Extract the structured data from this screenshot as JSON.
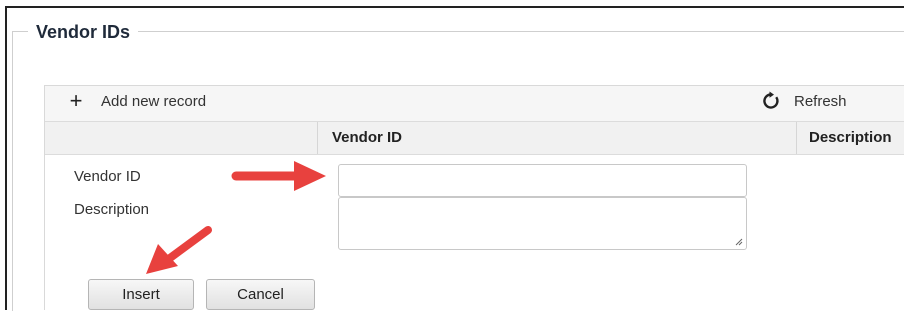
{
  "fieldset": {
    "legend": "Vendor IDs"
  },
  "toolbar": {
    "add_label": "Add new record",
    "add_icon": "plus-icon",
    "refresh_label": "Refresh",
    "refresh_icon": "refresh-icon"
  },
  "grid": {
    "columns": [
      "Vendor ID",
      "Description"
    ]
  },
  "edit_form": {
    "vendor_id_label": "Vendor ID",
    "vendor_id_value": "",
    "description_label": "Description",
    "description_value": ""
  },
  "buttons": {
    "insert": "Insert",
    "cancel": "Cancel"
  },
  "annotations": {
    "arrow_color": "#e8413e"
  },
  "colors": {
    "toolbar_bg": "#f6f6f6",
    "header_bg": "#f1f1f1"
  }
}
